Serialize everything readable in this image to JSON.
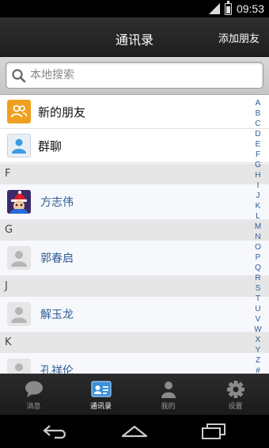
{
  "status": {
    "time": "09:53"
  },
  "header": {
    "title": "通讯录",
    "add_friend": "添加朋友"
  },
  "search": {
    "placeholder": "本地搜索"
  },
  "top_items": [
    {
      "label": "新的朋友",
      "icon": "new-friends-icon"
    },
    {
      "label": "群聊",
      "icon": "group-chat-icon"
    }
  ],
  "sections": [
    {
      "letter": "F",
      "contacts": [
        {
          "name": "方志伟"
        }
      ]
    },
    {
      "letter": "G",
      "contacts": [
        {
          "name": "郭春启"
        }
      ]
    },
    {
      "letter": "J",
      "contacts": [
        {
          "name": "解玉龙"
        }
      ]
    },
    {
      "letter": "K",
      "contacts": [
        {
          "name": "孔祥伦"
        }
      ]
    }
  ],
  "alphabet": [
    "A",
    "B",
    "C",
    "D",
    "E",
    "F",
    "G",
    "H",
    "I",
    "J",
    "K",
    "L",
    "M",
    "N",
    "O",
    "P",
    "Q",
    "R",
    "S",
    "T",
    "U",
    "V",
    "W",
    "X",
    "Y",
    "Z",
    "#"
  ],
  "tabs": [
    {
      "label": "消息",
      "icon": "chat-bubble-icon",
      "active": false
    },
    {
      "label": "通讯录",
      "icon": "contacts-card-icon",
      "active": true
    },
    {
      "label": "我的",
      "icon": "person-icon",
      "active": false
    },
    {
      "label": "设置",
      "icon": "gear-icon",
      "active": false
    }
  ],
  "colors": {
    "accent_orange": "#f0a020",
    "link_blue": "#2f5c93",
    "active_tab_blue": "#3a8fd8"
  }
}
